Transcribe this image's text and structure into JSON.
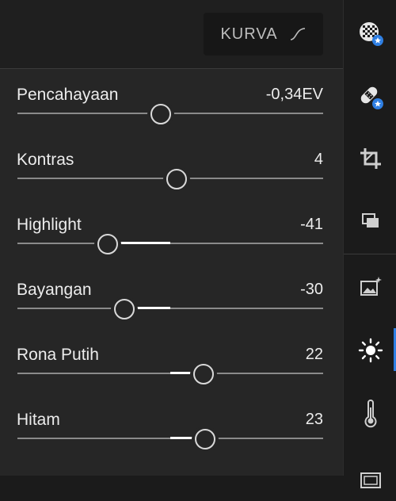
{
  "curve_button": {
    "label": "KURVA"
  },
  "sliders": [
    {
      "label": "Pencahayaan",
      "value": "-0,34EV",
      "position": 0.47,
      "center": 0.5
    },
    {
      "label": "Kontras",
      "value": "4",
      "position": 0.52,
      "center": 0.5
    },
    {
      "label": "Highlight",
      "value": "-41",
      "position": 0.295,
      "center": 0.5
    },
    {
      "label": "Bayangan",
      "value": "-30",
      "position": 0.35,
      "center": 0.5
    },
    {
      "label": "Rona Putih",
      "value": "22",
      "position": 0.61,
      "center": 0.5
    },
    {
      "label": "Hitam",
      "value": "23",
      "position": 0.615,
      "center": 0.5
    }
  ],
  "sidebar": {
    "items": [
      {
        "icon": "presets-icon",
        "badge": "star"
      },
      {
        "icon": "healing-icon",
        "badge": "star"
      },
      {
        "icon": "crop-icon"
      },
      {
        "icon": "versions-icon"
      },
      {
        "icon": "auto-enhance-icon"
      },
      {
        "icon": "light-icon",
        "active": true
      },
      {
        "icon": "color-temperature-icon"
      },
      {
        "icon": "effects-icon"
      }
    ],
    "accent": "#2f7fe3"
  }
}
